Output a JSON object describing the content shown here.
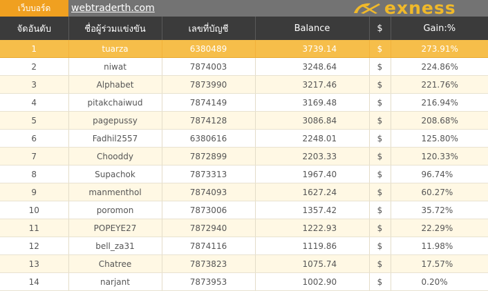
{
  "header": {
    "tag_label": "เว็บบอร์ด",
    "site_link": "webtraderth.com",
    "brand": "exness",
    "brand_color": "#f0b92a"
  },
  "table": {
    "columns": [
      "จัดอันดับ",
      "ชื่อผู้ร่วมแข่งขัน",
      "เลขที่บัญชี",
      "Balance",
      "$",
      "Gain:%"
    ],
    "rows": [
      {
        "rank": "1",
        "name": "tuarza",
        "account": "6380489",
        "balance": "3739.14",
        "currency": "$",
        "gain": "273.91%"
      },
      {
        "rank": "2",
        "name": "niwat",
        "account": "7874003",
        "balance": "3248.64",
        "currency": "$",
        "gain": "224.86%"
      },
      {
        "rank": "3",
        "name": "Alphabet",
        "account": "7873990",
        "balance": "3217.46",
        "currency": "$",
        "gain": "221.76%"
      },
      {
        "rank": "4",
        "name": "pitakchaiwud",
        "account": "7874149",
        "balance": "3169.48",
        "currency": "$",
        "gain": "216.94%"
      },
      {
        "rank": "5",
        "name": "pagepussy",
        "account": "7874128",
        "balance": "3086.84",
        "currency": "$",
        "gain": "208.68%"
      },
      {
        "rank": "6",
        "name": "Fadhil2557",
        "account": "6380616",
        "balance": "2248.01",
        "currency": "$",
        "gain": "125.80%"
      },
      {
        "rank": "7",
        "name": "Chooddy",
        "account": "7872899",
        "balance": "2203.33",
        "currency": "$",
        "gain": "120.33%"
      },
      {
        "rank": "8",
        "name": "Supachok",
        "account": "7873313",
        "balance": "1967.40",
        "currency": "$",
        "gain": "96.74%"
      },
      {
        "rank": "9",
        "name": "manmenthol",
        "account": "7874093",
        "balance": "1627.24",
        "currency": "$",
        "gain": "60.27%"
      },
      {
        "rank": "10",
        "name": "poromon",
        "account": "7873006",
        "balance": "1357.42",
        "currency": "$",
        "gain": "35.72%"
      },
      {
        "rank": "11",
        "name": "POPEYE27",
        "account": "7872940",
        "balance": "1222.93",
        "currency": "$",
        "gain": "22.29%"
      },
      {
        "rank": "12",
        "name": "bell_za31",
        "account": "7874116",
        "balance": "1119.86",
        "currency": "$",
        "gain": "11.98%"
      },
      {
        "rank": "13",
        "name": "Chatree",
        "account": "7873823",
        "balance": "1075.74",
        "currency": "$",
        "gain": "17.57%"
      },
      {
        "rank": "14",
        "name": "narjant",
        "account": "7873953",
        "balance": "1002.90",
        "currency": "$",
        "gain": "0.20%"
      }
    ]
  }
}
